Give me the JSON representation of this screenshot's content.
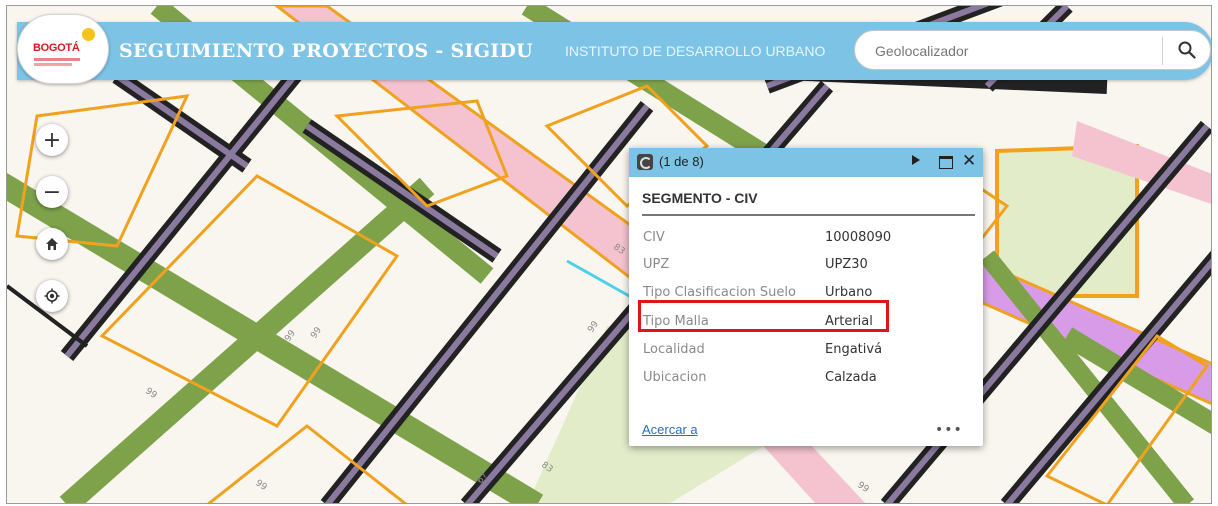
{
  "header": {
    "logo_text": "BOGOTÁ",
    "title": "SEGUIMIENTO PROYECTOS - SIGIDU",
    "subtitle": "INSTITUTO DE DESARROLLO URBANO",
    "search": {
      "placeholder": "Geolocalizador",
      "value": ""
    },
    "search_icon": "search-icon"
  },
  "map_controls": {
    "zoom_in": "+",
    "zoom_out": "−",
    "home_icon": "home-icon",
    "locate_icon": "locate-icon"
  },
  "map_labels": [
    "99",
    "99",
    "99",
    "99",
    "83",
    "83",
    "99",
    "67",
    "99"
  ],
  "popup": {
    "count": "(1 de 8)",
    "title": "SEGMENTO - CIV",
    "fields": [
      {
        "key": "CIV",
        "value": "10008090"
      },
      {
        "key": "UPZ",
        "value": "UPZ30"
      },
      {
        "key": "Tipo Clasificacion Suelo",
        "value": "Urbano"
      },
      {
        "key": "Tipo Malla",
        "value": "Arterial"
      },
      {
        "key": "Localidad",
        "value": "Engativá"
      },
      {
        "key": "Ubicacion",
        "value": "Calzada"
      }
    ],
    "highlighted_field": "Tipo Malla",
    "zoom_link": "Acercar a",
    "more": "•••"
  },
  "colors": {
    "header": "#7cc3e6",
    "highlight": "#e0141b",
    "road_green": "#7da24a",
    "road_pink": "#f4c3cf",
    "road_violet": "#d79be8",
    "block_outline": "#f0a21e",
    "park": "#e2ecc9"
  }
}
